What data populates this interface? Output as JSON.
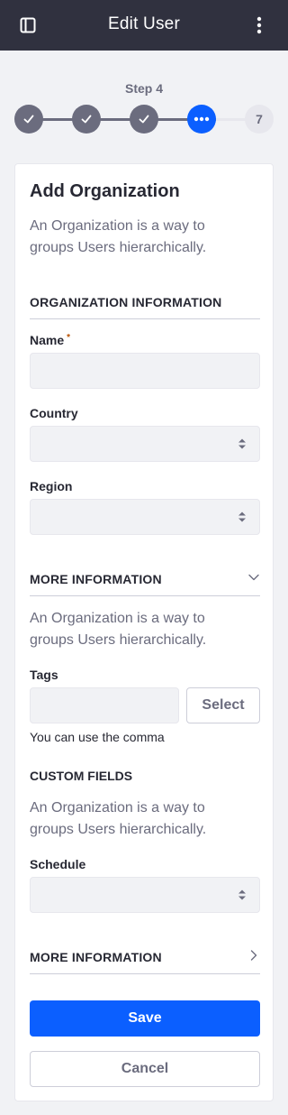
{
  "header": {
    "title": "Edit User",
    "left_icon": "sidebar-panel-icon",
    "right_icon": "vertical-ellipsis-icon"
  },
  "stepper": {
    "label": "Step 4",
    "steps": [
      {
        "state": "done",
        "icon": "check-icon"
      },
      {
        "state": "done",
        "icon": "check-icon"
      },
      {
        "state": "done",
        "icon": "check-icon"
      },
      {
        "state": "active",
        "icon": "ellipsis-icon"
      },
      {
        "state": "todo",
        "text": "7"
      }
    ]
  },
  "form": {
    "heading": "Add Organization",
    "intro": "An Organization is a way to groups Users hierarchically.",
    "section_org_info": "ORGANIZATION INFORMATION",
    "name_label": "Name",
    "name_required": "*",
    "name_value": "",
    "country_label": "Country",
    "country_value": "",
    "region_label": "Region",
    "region_value": "",
    "section_more_info_1": "MORE INFORMATION",
    "more_info_desc": "An Organization is a way to groups Users hierarchically.",
    "tags_label": "Tags",
    "tags_value": "",
    "tags_select": "Select",
    "tags_hint": "You can use the comma",
    "section_custom_fields": "CUSTOM FIELDS",
    "custom_fields_desc": "An Organization is a way to groups Users hierarchically.",
    "schedule_label": "Schedule",
    "schedule_value": "",
    "section_more_info_2": "MORE INFORMATION",
    "save": "Save",
    "cancel": "Cancel"
  },
  "colors": {
    "header_bg": "#30313f",
    "page_bg": "#f1f2f5",
    "primary": "#0b5fff",
    "step_done": "#6b6c7e",
    "required": "#b95000"
  }
}
